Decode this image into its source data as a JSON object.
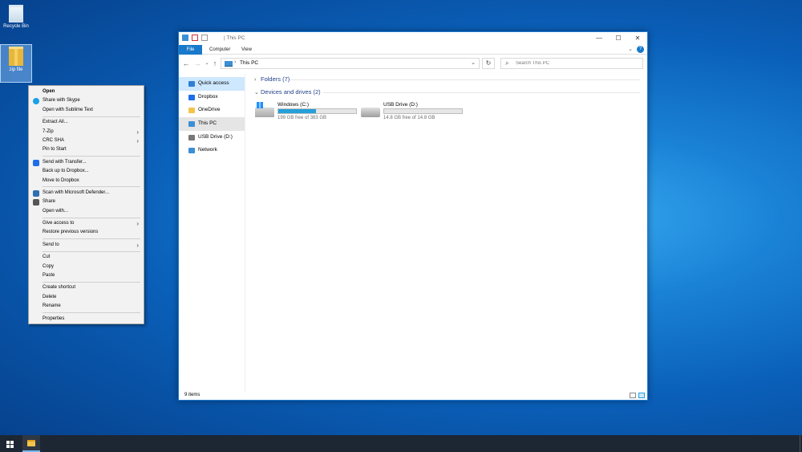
{
  "desktop": {
    "icons": [
      {
        "label": "Recycle Bin"
      },
      {
        "label": "zip file"
      }
    ]
  },
  "context_menu": {
    "items": [
      {
        "label": "Open",
        "icon": "none",
        "submenu": false,
        "bold": true
      },
      {
        "label": "Share with Skype",
        "icon": "skype-icon",
        "submenu": false
      },
      {
        "label": "Open with Sublime Text",
        "icon": "none",
        "submenu": false
      },
      "sep",
      {
        "label": "Extract All...",
        "icon": "none",
        "submenu": false
      },
      {
        "label": "7-Zip",
        "icon": "none",
        "submenu": true
      },
      {
        "label": "CRC SHA",
        "icon": "none",
        "submenu": true
      },
      {
        "label": "Pin to Start",
        "icon": "none",
        "submenu": false
      },
      "sep",
      {
        "label": "Send with Transfer...",
        "icon": "dropbox-icon",
        "submenu": false
      },
      {
        "label": "Back up to Dropbox...",
        "icon": "none",
        "submenu": false
      },
      {
        "label": "Move to Dropbox",
        "icon": "none",
        "submenu": false
      },
      "sep",
      {
        "label": "Scan with Microsoft Defender...",
        "icon": "defender-icon",
        "submenu": false
      },
      {
        "label": "Share",
        "icon": "share-icon",
        "submenu": false
      },
      {
        "label": "Open with...",
        "icon": "none",
        "submenu": false
      },
      "sep",
      {
        "label": "Give access to",
        "icon": "none",
        "submenu": true
      },
      {
        "label": "Restore previous versions",
        "icon": "none",
        "submenu": false
      },
      "sep",
      {
        "label": "Send to",
        "icon": "none",
        "submenu": true
      },
      "sep",
      {
        "label": "Cut",
        "icon": "none",
        "submenu": false
      },
      {
        "label": "Copy",
        "icon": "none",
        "submenu": false
      },
      {
        "label": "Paste",
        "icon": "none",
        "submenu": false
      },
      "sep",
      {
        "label": "Create shortcut",
        "icon": "none",
        "submenu": false
      },
      {
        "label": "Delete",
        "icon": "none",
        "submenu": false
      },
      {
        "label": "Rename",
        "icon": "none",
        "submenu": false
      },
      "sep",
      {
        "label": "Properties",
        "icon": "none",
        "submenu": false
      }
    ]
  },
  "explorer": {
    "title": "This PC",
    "title_sep": "|",
    "window_controls": {
      "minimize": "—",
      "maximize": "☐",
      "close": "✕"
    },
    "ribbon": {
      "tabs": [
        "File",
        "Computer",
        "View"
      ],
      "collapse": "⌄",
      "help": "?"
    },
    "nav": {
      "back": "←",
      "forward": "→",
      "recent": "⌄",
      "up": "↑",
      "refresh": "↻",
      "search_glyph": "⌕"
    },
    "address": {
      "separator": "›",
      "path": "This PC",
      "dropdown": "⌄"
    },
    "search": {
      "placeholder": "Search This PC"
    },
    "sidebar": [
      {
        "label": "Quick access",
        "icon": "star-icon",
        "color": "#2f7fd4",
        "state": "selected"
      },
      {
        "label": "Dropbox",
        "icon": "dropbox-icon",
        "color": "#1d6ee8",
        "state": ""
      },
      {
        "label": "OneDrive",
        "icon": "folder-icon",
        "color": "#f3c44a",
        "state": ""
      },
      {
        "label": "This PC",
        "icon": "computer-icon",
        "color": "#3c8fd6",
        "state": "active"
      },
      {
        "label": "USB Drive (D:)",
        "icon": "usb-drive-icon",
        "color": "#777777",
        "state": ""
      },
      {
        "label": "Network",
        "icon": "network-icon",
        "color": "#3c8fd6",
        "state": ""
      }
    ],
    "groups": {
      "folders": {
        "chevron": "›",
        "label": "Folders (7)"
      },
      "devices": {
        "chevron": "⌄",
        "label": "Devices and drives (2)"
      }
    },
    "drives": [
      {
        "name": "Windows (C:)",
        "free_text": "199 GB free of 383 GB",
        "used_fraction": 0.48,
        "icon": "windows-drive-icon",
        "bar_color": "#26a0da"
      },
      {
        "name": "USB Drive (D:)",
        "free_text": "14.8 GB free of 14.8 GB",
        "used_fraction": 0.0,
        "icon": "usb-drive-icon",
        "bar_color": "#26a0da"
      }
    ],
    "status": {
      "items": "9 items"
    }
  },
  "taskbar": {
    "pinned": [
      "start-button",
      "file-explorer"
    ]
  }
}
